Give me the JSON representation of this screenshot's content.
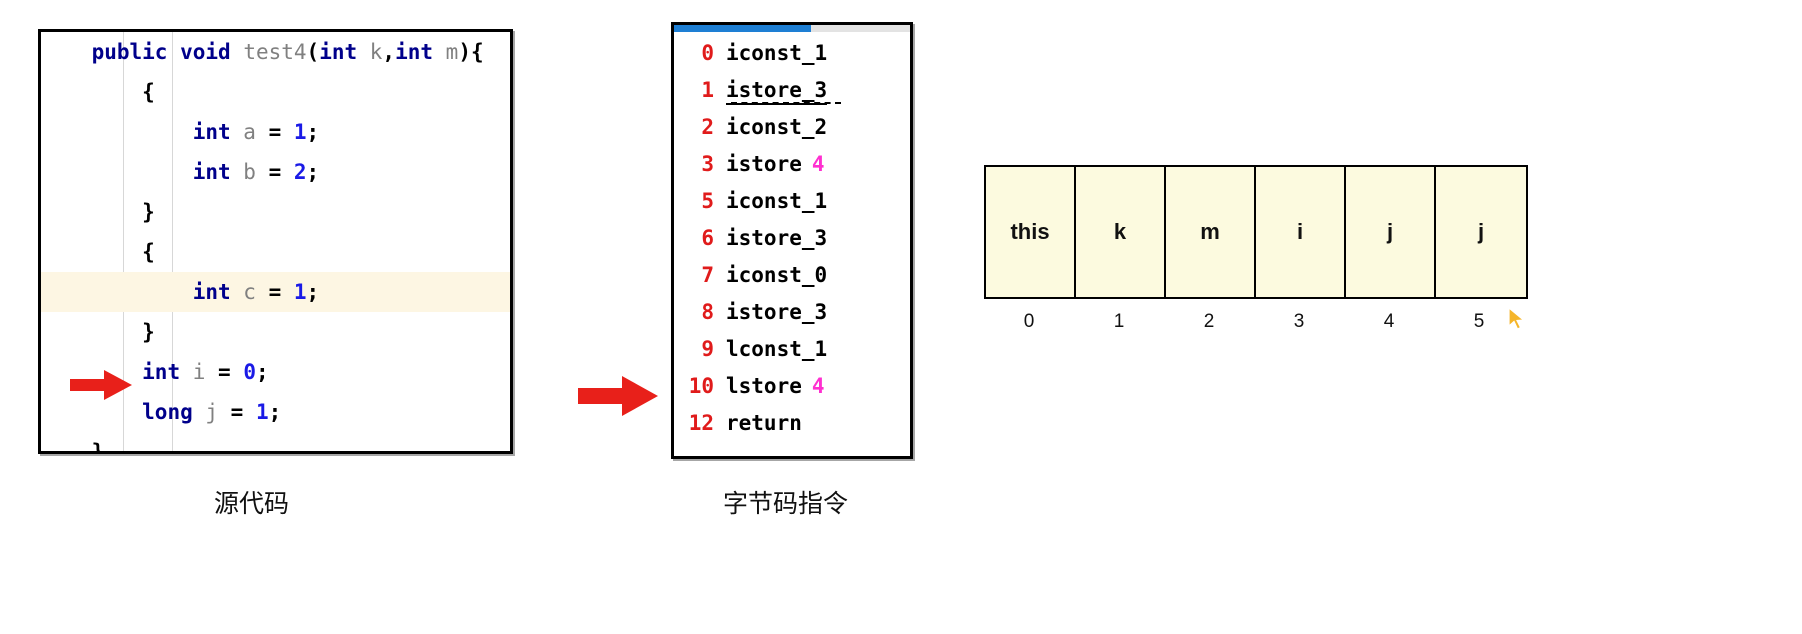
{
  "source_panel": {
    "name": "source-code-editor",
    "lines": [
      {
        "indent": 0,
        "tokens": [
          {
            "t": "kw",
            "v": "public "
          },
          {
            "t": "kw",
            "v": "void "
          },
          {
            "t": "id",
            "v": "test4"
          },
          {
            "t": "pun",
            "v": "("
          },
          {
            "t": "kw",
            "v": "int "
          },
          {
            "t": "id",
            "v": "k"
          },
          {
            "t": "pun",
            "v": ","
          },
          {
            "t": "kw",
            "v": "int "
          },
          {
            "t": "id",
            "v": "m"
          },
          {
            "t": "pun",
            "v": "){"
          }
        ],
        "highlight": false
      },
      {
        "indent": 1,
        "tokens": [
          {
            "t": "brace",
            "v": "{"
          }
        ],
        "highlight": false
      },
      {
        "indent": 2,
        "tokens": [
          {
            "t": "kw",
            "v": "int "
          },
          {
            "t": "id",
            "v": "a "
          },
          {
            "t": "pun",
            "v": "= "
          },
          {
            "t": "num",
            "v": "1"
          },
          {
            "t": "pun",
            "v": ";"
          }
        ],
        "highlight": false
      },
      {
        "indent": 2,
        "tokens": [
          {
            "t": "kw",
            "v": "int "
          },
          {
            "t": "id",
            "v": "b "
          },
          {
            "t": "pun",
            "v": "= "
          },
          {
            "t": "num",
            "v": "2"
          },
          {
            "t": "pun",
            "v": ";"
          }
        ],
        "highlight": false
      },
      {
        "indent": 1,
        "tokens": [
          {
            "t": "brace",
            "v": "}"
          }
        ],
        "highlight": false
      },
      {
        "indent": 1,
        "tokens": [
          {
            "t": "brace",
            "v": "{"
          }
        ],
        "highlight": false
      },
      {
        "indent": 2,
        "tokens": [
          {
            "t": "kw",
            "v": "int "
          },
          {
            "t": "id",
            "v": "c "
          },
          {
            "t": "pun",
            "v": "= "
          },
          {
            "t": "num",
            "v": "1"
          },
          {
            "t": "pun",
            "v": ";"
          }
        ],
        "highlight": true
      },
      {
        "indent": 1,
        "tokens": [
          {
            "t": "brace",
            "v": "}"
          }
        ],
        "highlight": false
      },
      {
        "indent": 1,
        "tokens": [
          {
            "t": "kw",
            "v": "int "
          },
          {
            "t": "id",
            "v": "i "
          },
          {
            "t": "pun",
            "v": "= "
          },
          {
            "t": "num",
            "v": "0"
          },
          {
            "t": "pun",
            "v": ";"
          }
        ],
        "highlight": false
      },
      {
        "indent": 1,
        "tokens": [
          {
            "t": "kw",
            "v": "long "
          },
          {
            "t": "id",
            "v": "j "
          },
          {
            "t": "pun",
            "v": "= "
          },
          {
            "t": "num",
            "v": "1"
          },
          {
            "t": "pun",
            "v": ";"
          }
        ],
        "highlight": false
      },
      {
        "indent": 0,
        "tokens": [
          {
            "t": "brace",
            "v": "}"
          }
        ],
        "highlight": false
      }
    ]
  },
  "bytecode_panel": {
    "name": "bytecode-instructions",
    "scrollbar_color": "#1e7fd4",
    "instructions": [
      {
        "offset": "0",
        "mnemonic": "iconst_1",
        "operand": "",
        "underline": false
      },
      {
        "offset": "1",
        "mnemonic": "istore_3",
        "operand": "",
        "underline": true
      },
      {
        "offset": "2",
        "mnemonic": "iconst_2",
        "operand": "",
        "underline": false
      },
      {
        "offset": "3",
        "mnemonic": "istore",
        "operand": "4",
        "underline": false
      },
      {
        "offset": "5",
        "mnemonic": "iconst_1",
        "operand": "",
        "underline": false
      },
      {
        "offset": "6",
        "mnemonic": "istore_3",
        "operand": "",
        "underline": false
      },
      {
        "offset": "7",
        "mnemonic": "iconst_0",
        "operand": "",
        "underline": false
      },
      {
        "offset": "8",
        "mnemonic": "istore_3",
        "operand": "",
        "underline": false
      },
      {
        "offset": "9",
        "mnemonic": "lconst_1",
        "operand": "",
        "underline": false
      },
      {
        "offset": "10",
        "mnemonic": "lstore",
        "operand": "4",
        "underline": false
      },
      {
        "offset": "12",
        "mnemonic": "return",
        "operand": "",
        "underline": false
      }
    ]
  },
  "slot_table": {
    "name": "local-variable-slot-table",
    "cells": [
      "this",
      "k",
      "m",
      "i",
      "j",
      "j"
    ],
    "indices": [
      "0",
      "1",
      "2",
      "3",
      "4",
      "5"
    ],
    "cell_color": "#fcfadf"
  },
  "captions": {
    "source": "源代码",
    "bytecode": "字节码指令"
  },
  "colors": {
    "keyword": "#00008b",
    "identifier": "#808080",
    "literal": "#1a1ae6",
    "offset": "#e01b1b",
    "operand": "#ff2fd0",
    "arrow": "#e8201a",
    "highlight_row": "#fdf6e3"
  }
}
